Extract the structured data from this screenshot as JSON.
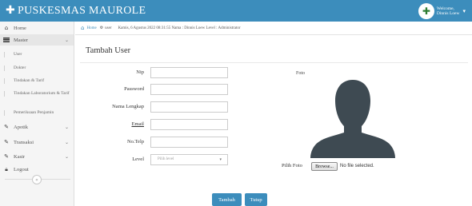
{
  "app": {
    "title": "PUSKESMAS MAUROLE"
  },
  "user_menu": {
    "welcome_line1": "Welcome,",
    "welcome_line2": "Dinnis Loew"
  },
  "sidebar": {
    "home_label": "Home",
    "master_label": "Master",
    "master_items": [
      "User",
      "Dokter",
      "Tindakan & Tarif",
      "Tindakan Laboratorium & Tarif",
      "Pemeriksaan Penjamin"
    ],
    "apotik_label": "Apotik",
    "transaksi_label": "Transaksi",
    "kasir_label": "Kasir",
    "logout_label": "Logout"
  },
  "breadcrumb": {
    "home_label": "Home",
    "current_label": "user",
    "info": "Kamis, 6 Agustus 2022 08:31:55  Nama : Dinnis Loew  Level : Administrator"
  },
  "page": {
    "title": "Tambah User"
  },
  "form": {
    "nip_label": "Nip",
    "password_label": "Password",
    "nama_label": "Nama Lengkap",
    "email_label": "Email",
    "telp_label": "No.Telp",
    "level_label": "Level",
    "level_placeholder": "Pilih level",
    "foto_label": "Foto",
    "pilih_foto_label": "Pilih Foto",
    "browse_label": "Browse...",
    "file_status": "No file selected.",
    "tambah_label": "Tambah",
    "tutup_label": "Tutup"
  },
  "colors": {
    "primary": "#3c8dbc",
    "sidebar_bg": "#f5f5f5",
    "silhouette": "#3e4a52"
  }
}
